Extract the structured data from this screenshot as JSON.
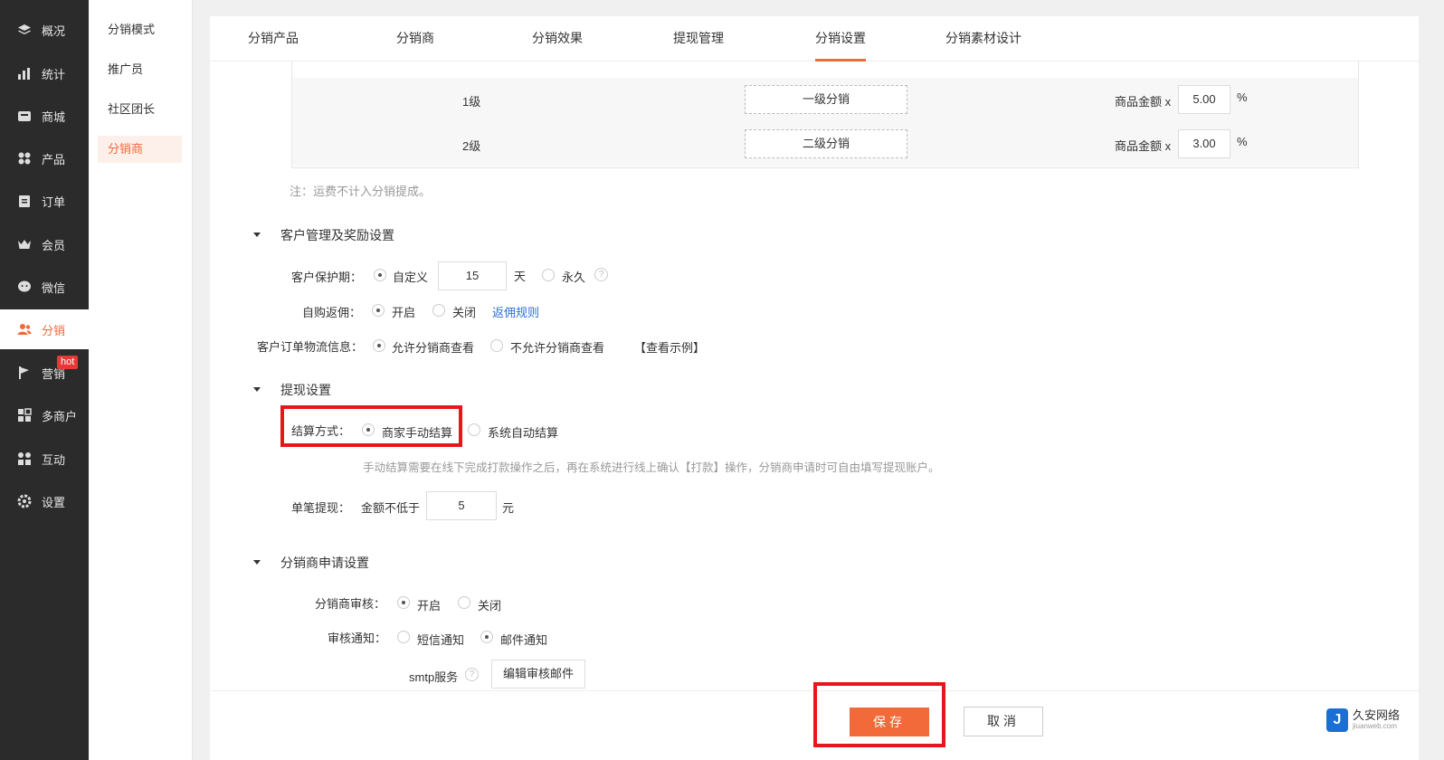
{
  "sidebar": {
    "items": [
      {
        "label": "概况",
        "icon": "layers-icon"
      },
      {
        "label": "统计",
        "icon": "bar-chart-icon"
      },
      {
        "label": "商城",
        "icon": "store-icon"
      },
      {
        "label": "产品",
        "icon": "grid-icon"
      },
      {
        "label": "订单",
        "icon": "clipboard-icon"
      },
      {
        "label": "会员",
        "icon": "crown-icon"
      },
      {
        "label": "微信",
        "icon": "chat-icon"
      },
      {
        "label": "分销",
        "icon": "users-icon"
      },
      {
        "label": "营销",
        "icon": "flag-icon"
      },
      {
        "label": "多商户",
        "icon": "multi-store-icon"
      },
      {
        "label": "互动",
        "icon": "interact-icon"
      },
      {
        "label": "设置",
        "icon": "gear-icon"
      }
    ],
    "active_index": 7,
    "hot_badge": "hot",
    "accent": "#f26a3a"
  },
  "subnav": {
    "items": [
      "分销模式",
      "推广员",
      "社区团长",
      "分销商"
    ],
    "active_index": 3
  },
  "tabs": {
    "items": [
      "分销产品",
      "分销商",
      "分销效果",
      "提现管理",
      "分销设置",
      "分销素材设计"
    ],
    "active_index": 4
  },
  "levels": {
    "rows": [
      {
        "level": "1级",
        "name": "一级分销",
        "amount_label": "商品金额 x",
        "value": "5.00",
        "unit": "%"
      },
      {
        "level": "2级",
        "name": "二级分销",
        "amount_label": "商品金额 x",
        "value": "3.00",
        "unit": "%"
      }
    ],
    "note": "注：运费不计入分销提成。"
  },
  "customer_section": {
    "title": "客户管理及奖励设置",
    "protect_label": "客户保护期：",
    "protect_custom": "自定义",
    "protect_days": "15",
    "protect_unit": "天",
    "protect_forever": "永久",
    "self_buy_label": "自购返佣：",
    "self_buy_on": "开启",
    "self_buy_off": "关闭",
    "self_buy_link": "返佣规则",
    "logistics_label": "客户订单物流信息：",
    "logistics_allow": "允许分销商查看",
    "logistics_deny": "不允许分销商查看",
    "logistics_example": "【查看示例】"
  },
  "withdraw_section": {
    "title": "提现设置",
    "settle_label": "结算方式：",
    "settle_manual": "商家手动结算",
    "settle_auto": "系统自动结算",
    "settle_note": "手动结算需要在线下完成打款操作之后，再在系统进行线上确认【打款】操作，分销商申请时可自由填写提现账户。",
    "single_label": "单笔提现：",
    "single_prefix": "金额不低于",
    "single_value": "5",
    "single_unit": "元"
  },
  "apply_section": {
    "title": "分销商申请设置",
    "audit_label": "分销商审核：",
    "audit_on": "开启",
    "audit_off": "关闭",
    "notify_label": "审核通知：",
    "notify_sms": "短信通知",
    "notify_mail": "邮件通知",
    "smtp_label": "smtp服务",
    "smtp_button": "编辑审核邮件"
  },
  "footer": {
    "save": "保存",
    "cancel": "取消"
  },
  "watermark": {
    "name": "久安网络",
    "domain": "jiuanweb.com",
    "letter": "J"
  }
}
